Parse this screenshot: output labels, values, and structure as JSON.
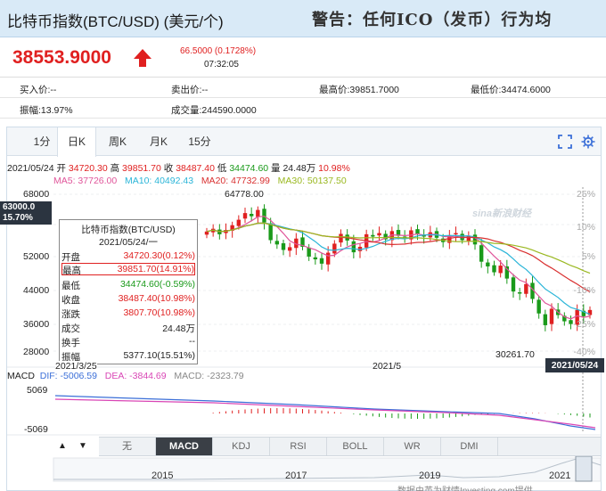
{
  "header": {
    "title": "比特币指数(BTC/USD) (美元/个)",
    "marquee": "警告：任何ICO（发币）行为均"
  },
  "quote": {
    "price": "38553.9000",
    "change": "66.5000 (0.1728%)",
    "time": "07:32:05"
  },
  "info": {
    "bid_label": "买入价:",
    "bid": "--",
    "ask_label": "卖出价:",
    "ask": "--",
    "high_label": "最高价:",
    "high": "39851.7000",
    "low_label": "最低价:",
    "low": "34474.6000",
    "amplitude_label": "振幅:",
    "amplitude": "13.97%",
    "volume_label": "成交量:",
    "volume": "244590.0000"
  },
  "tabs": [
    "1分",
    "日K",
    "周K",
    "月K",
    "15分"
  ],
  "active_tab": "日K",
  "ohlc_line": {
    "date": "2021/05/24",
    "open_label": "开",
    "open": "34720.30",
    "high_label": "高",
    "high": "39851.70",
    "close_label": "收",
    "close": "38487.40",
    "low_label": "低",
    "low": "34474.60",
    "volume_label": "量",
    "volume": "24.48万",
    "pct": "10.98%"
  },
  "ma": {
    "ma5": "MA5: 37726.00",
    "ma10": "MA10: 40492.43",
    "ma20": "MA20: 47732.99",
    "ma30": "MA30: 50137.50",
    "colors": {
      "ma5": "#e0559a",
      "ma10": "#2bb5d8",
      "ma20": "#d93030",
      "ma30": "#9ab820"
    }
  },
  "chart_data": {
    "type": "candlestick",
    "y_ticks": [
      "68000",
      "52000",
      "44000",
      "36000",
      "28000"
    ],
    "pct_ticks": [
      "25%",
      "10%",
      "5%",
      "-10%",
      "-25%",
      "-40%"
    ],
    "last_price": "63000.0",
    "last_pct": "15.70%",
    "max_label": "64778.00",
    "min_label": "30261.70",
    "date_labels": [
      "2021/3/25",
      "2021/5",
      "2021/05/24"
    ],
    "watermark": "sina新浪财经",
    "colors": {
      "up": "#e02020",
      "down": "#1a9a1a"
    }
  },
  "tooltip": {
    "title": "比特币指数(BTC/USD)",
    "date": "2021/05/24/一",
    "rows": [
      {
        "k": "开盘",
        "v": "34720.30(0.12%)",
        "c": "red"
      },
      {
        "k": "最高",
        "v": "39851.70(14.91%)",
        "c": "red"
      },
      {
        "k": "最低",
        "v": "34474.60(-0.59%)",
        "c": "green"
      },
      {
        "k": "收盘",
        "v": "38487.40(10.98%)",
        "c": "red"
      },
      {
        "k": "涨跌",
        "v": "3807.70(10.98%)",
        "c": "red"
      },
      {
        "k": "成交",
        "v": "24.48万",
        "c": "black"
      },
      {
        "k": "换手",
        "v": "--",
        "c": "black"
      },
      {
        "k": "振幅",
        "v": "5377.10(15.51%)",
        "c": "black"
      }
    ]
  },
  "macd": {
    "label": "MACD",
    "dif": "DIF: -5006.59",
    "dea": "DEA: -3844.69",
    "macd": "MACD: -2323.79",
    "top": "5069",
    "bottom": "-5069"
  },
  "indicators": [
    "无",
    "MACD",
    "KDJ",
    "RSI",
    "BOLL",
    "WR",
    "DMI"
  ],
  "active_indicator": "MACD",
  "years": [
    "2015",
    "2017",
    "2019",
    "2021"
  ],
  "footer": "数据由英为财情Investing.com提供"
}
